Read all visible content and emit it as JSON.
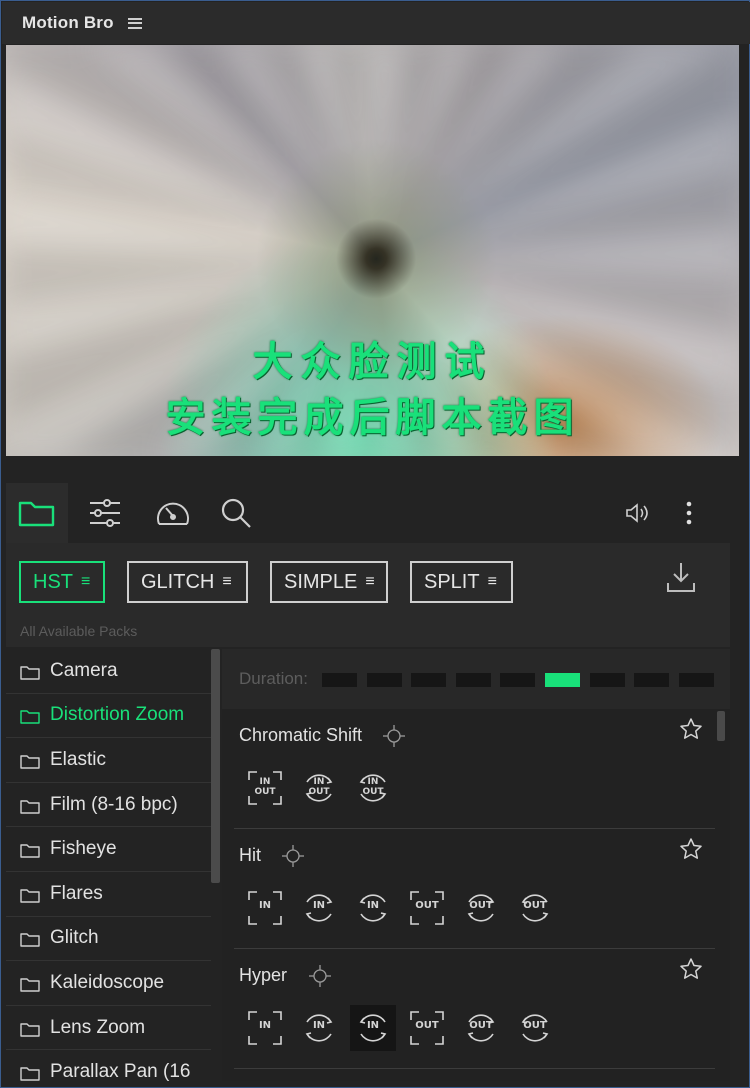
{
  "app": {
    "title": "Motion Bro"
  },
  "preview": {
    "caption_line1": "大众脸测试",
    "caption_line2": "安装完成后脚本截图",
    "caption_color": "#19e07a"
  },
  "toolbar": {
    "left_icons": [
      "folder-icon",
      "sliders-icon",
      "speedometer-icon",
      "search-icon"
    ],
    "right_icons": [
      "volume-icon",
      "more-vertical-icon"
    ],
    "active": "folder-icon"
  },
  "packs": {
    "items": [
      {
        "label": "HST",
        "active": true
      },
      {
        "label": "GLITCH",
        "active": false
      },
      {
        "label": "SIMPLE",
        "active": false
      },
      {
        "label": "SPLIT",
        "active": false
      }
    ],
    "menu_glyph": "≡",
    "subtitle": "All Available Packs",
    "download_icon": "download-icon"
  },
  "categories": {
    "items": [
      {
        "label": "Camera",
        "active": false
      },
      {
        "label": "Distortion Zoom",
        "active": true
      },
      {
        "label": "Elastic",
        "active": false
      },
      {
        "label": "Film (8-16 bpc)",
        "active": false
      },
      {
        "label": "Fisheye",
        "active": false
      },
      {
        "label": "Flares",
        "active": false
      },
      {
        "label": "Glitch",
        "active": false
      },
      {
        "label": "Kaleidoscope",
        "active": false
      },
      {
        "label": "Lens Zoom",
        "active": false
      },
      {
        "label": "Parallax Pan (16",
        "active": false
      }
    ]
  },
  "duration": {
    "label": "Duration:",
    "segments": 9,
    "selected_index": 5,
    "accent": "#19e07a"
  },
  "effects": [
    {
      "name": "Chromatic Shift",
      "buttons": [
        {
          "kind": "in-out",
          "top": "IN",
          "bottom": "OUT"
        },
        {
          "kind": "in-out-cw",
          "top": "IN",
          "bottom": "OUT"
        },
        {
          "kind": "in-out-ccw",
          "top": "IN",
          "bottom": "OUT"
        }
      ],
      "selected": -1
    },
    {
      "name": "Hit",
      "buttons": [
        {
          "kind": "in",
          "top": "IN"
        },
        {
          "kind": "in-cw",
          "top": "IN"
        },
        {
          "kind": "in-ccw",
          "top": "IN"
        },
        {
          "kind": "out",
          "top": "OUT"
        },
        {
          "kind": "out-cw",
          "top": "OUT"
        },
        {
          "kind": "out-ccw",
          "top": "OUT"
        }
      ],
      "selected": -1
    },
    {
      "name": "Hyper",
      "buttons": [
        {
          "kind": "in",
          "top": "IN"
        },
        {
          "kind": "in-cw",
          "top": "IN"
        },
        {
          "kind": "in-ccw",
          "top": "IN"
        },
        {
          "kind": "out",
          "top": "OUT"
        },
        {
          "kind": "out-cw",
          "top": "OUT"
        },
        {
          "kind": "out-ccw",
          "top": "OUT"
        }
      ],
      "selected": 2
    }
  ]
}
